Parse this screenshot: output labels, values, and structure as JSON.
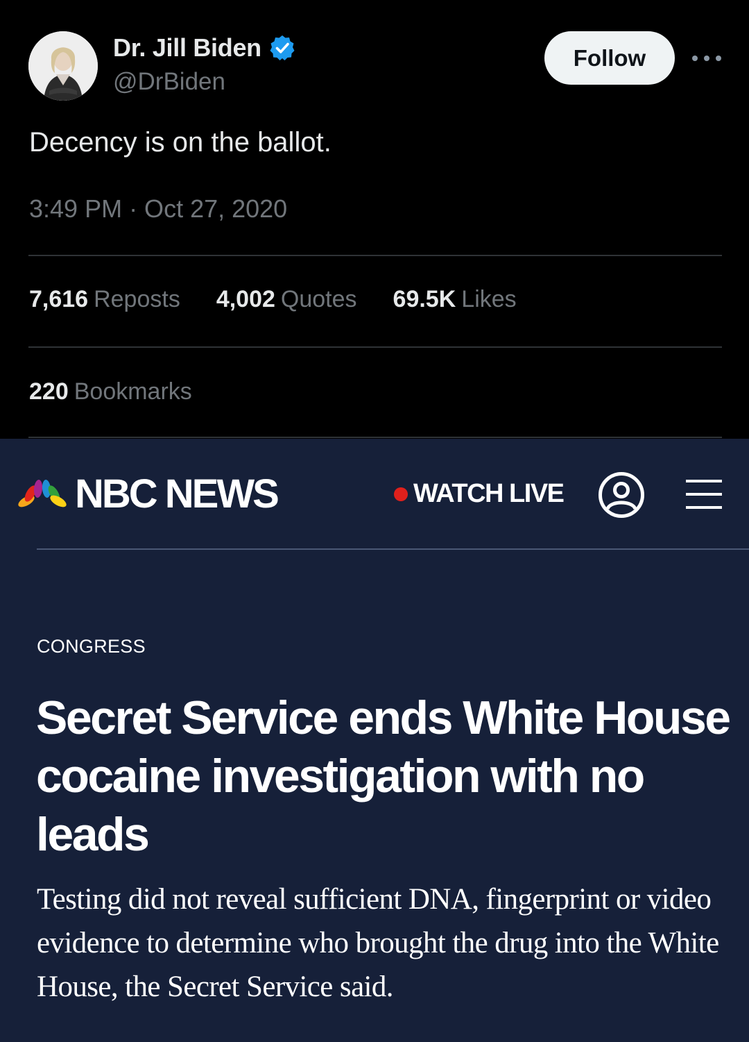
{
  "tweet": {
    "author_name": "Dr. Jill Biden",
    "handle": "@DrBiden",
    "follow_label": "Follow",
    "text": "Decency is on the ballot.",
    "timestamp": "3:49 PM · Oct 27, 2020",
    "stats": [
      {
        "count": "7,616",
        "label": "Reposts"
      },
      {
        "count": "4,002",
        "label": "Quotes"
      },
      {
        "count": "69.5K",
        "label": "Likes"
      }
    ],
    "bookmarks": {
      "count": "220",
      "label": "Bookmarks"
    },
    "colors": {
      "verified": "#1d9bf0",
      "background": "#000000"
    }
  },
  "nbc": {
    "brand": "NBC NEWS",
    "watch_live": "WATCH LIVE",
    "section": "CONGRESS",
    "headline": "Secret Service ends White House cocaine investigation with no leads",
    "dek": "Testing did not reveal sufficient DNA, fingerprint or video evidence to determine who brought the drug into the White House, the Secret Service said.",
    "colors": {
      "background": "#162039",
      "live_dot": "#e0201c"
    }
  }
}
